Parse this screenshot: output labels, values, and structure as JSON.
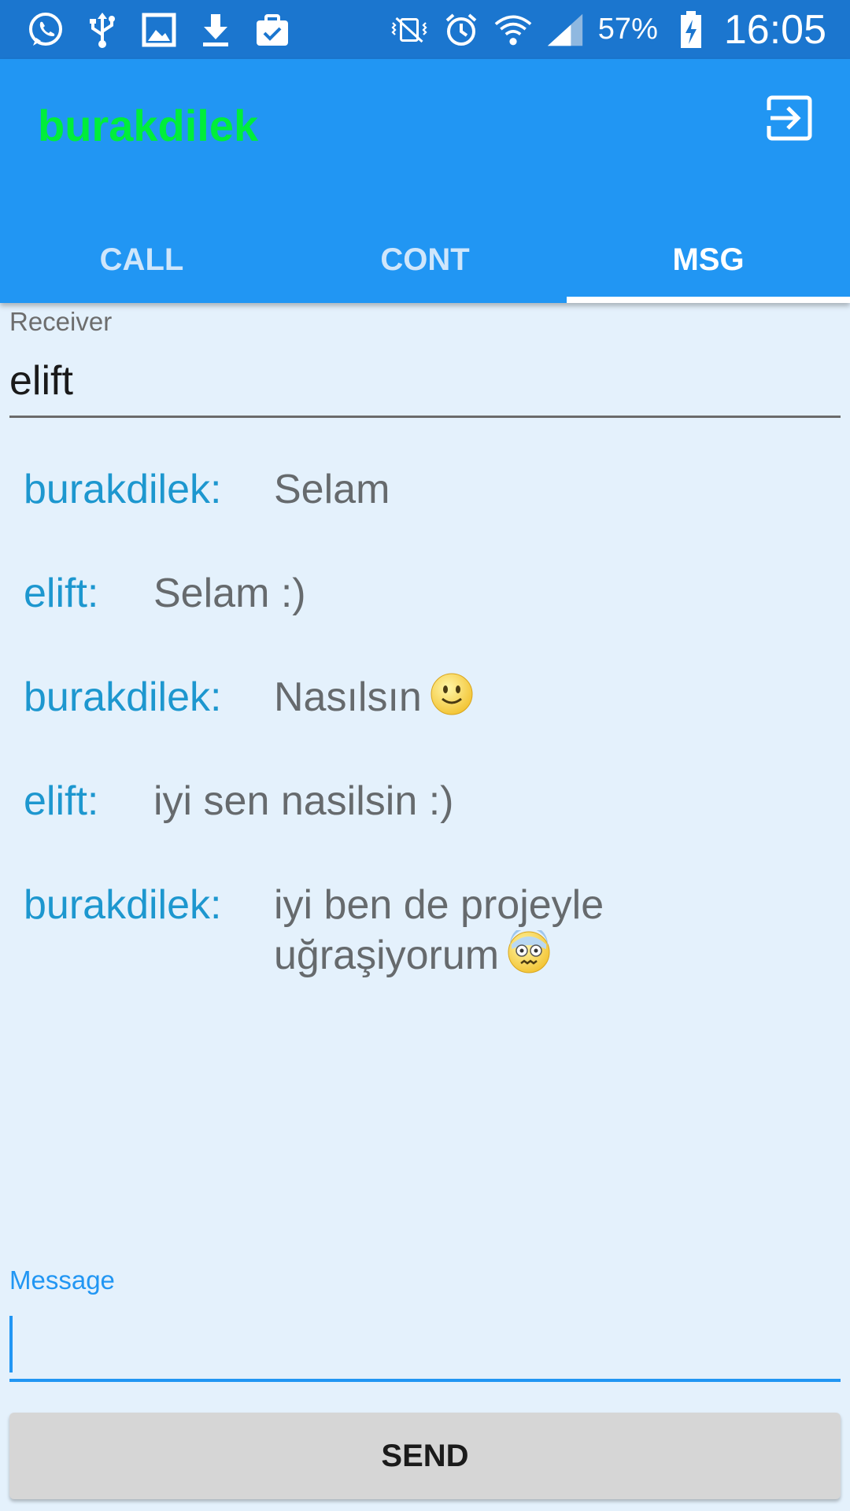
{
  "status_bar": {
    "battery": "57%",
    "time": "16:05",
    "left_icons": [
      "whatsapp-icon",
      "usb-icon",
      "image-icon",
      "download-icon",
      "clipboard-check-icon"
    ],
    "right_icons": [
      "vibrate-icon",
      "alarm-icon",
      "wifi-icon",
      "signal-icon",
      "battery-charging-icon"
    ]
  },
  "app_bar": {
    "title": "burakdilek",
    "title_color": "#00ee3a",
    "background": "#2196f3",
    "exit_icon": "exit-to-app-icon"
  },
  "tabs": [
    {
      "label": "CALL",
      "active": false
    },
    {
      "label": "CONT",
      "active": false
    },
    {
      "label": "MSG",
      "active": true
    }
  ],
  "receiver": {
    "label": "Receiver",
    "value": "elift"
  },
  "messages": [
    {
      "sender": "burakdilek:",
      "text": "Selam",
      "emoji": ""
    },
    {
      "sender": "elift:",
      "text": "Selam :)",
      "emoji": ""
    },
    {
      "sender": "burakdilek:",
      "text": "Nasılsın",
      "emoji": "smile-emoji"
    },
    {
      "sender": "elift:",
      "text": "iyi sen nasilsin :)",
      "emoji": ""
    },
    {
      "sender": "burakdilek:",
      "text": "iyi ben de projeyle uğraşiyorum",
      "emoji": "anxious-face-emoji"
    }
  ],
  "message_input": {
    "label": "Message",
    "value": ""
  },
  "send_button": {
    "label": "SEND"
  },
  "colors": {
    "sender": "#1d97cf",
    "message_text": "#666a6d",
    "accent": "#2196f3"
  }
}
